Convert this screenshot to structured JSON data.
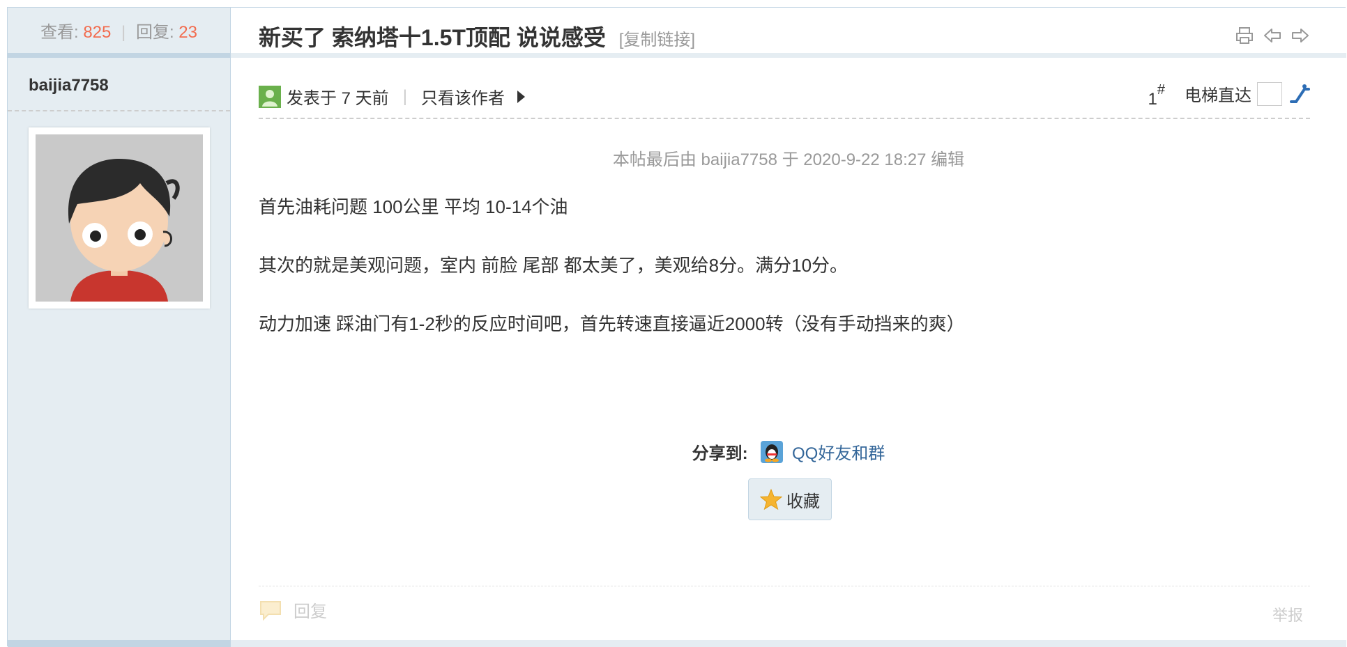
{
  "stats": {
    "views_label": "查看:",
    "views_count": "825",
    "separator": "|",
    "replies_label": "回复:",
    "replies_count": "23"
  },
  "author": {
    "name": "baijia7758"
  },
  "thread": {
    "title": "新买了 索纳塔十1.5T顶配 说说感受",
    "copy_link": "[复制链接]"
  },
  "post": {
    "posted_time": "发表于 7 天前",
    "separator": "|",
    "only_author": "只看该作者",
    "floor_number": "1",
    "floor_suffix": "#",
    "jump_label": "电梯直达",
    "edit_note": "本帖最后由 baijia7758 于 2020-9-22 18:27 编辑",
    "paragraphs": [
      "首先油耗问题 100公里 平均 10-14个油",
      "其次的就是美观问题，室内 前脸 尾部 都太美了，美观给8分。满分10分。",
      "动力加速 踩油门有1-2秒的反应时间吧，首先转速直接逼近2000转（没有手动挡来的爽）"
    ]
  },
  "share": {
    "label": "分享到:",
    "qq_link": "QQ好友和群"
  },
  "favorite": {
    "label": "收藏"
  },
  "footer": {
    "reply_label": "回复",
    "report_label": "举报"
  },
  "icons": {
    "print": "print-icon",
    "prev": "prev-thread-icon",
    "next": "next-thread-icon",
    "user": "user-icon",
    "jump": "elevator-icon",
    "qq": "qq-icon",
    "star": "star-icon",
    "reply": "reply-bubble-icon"
  },
  "colors": {
    "accent_count": "#f26c4f",
    "link": "#336699",
    "sidebar_bg": "#e5edf2",
    "border": "#c2d5e3"
  }
}
